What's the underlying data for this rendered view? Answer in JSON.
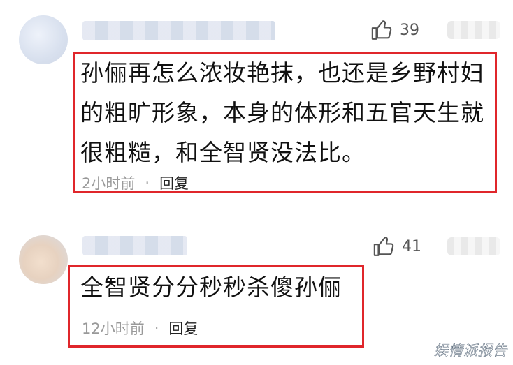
{
  "comments": [
    {
      "likes": "39",
      "text_lines": [
        "孙俪再怎么浓妆艳抹，也还是乡野村妇",
        "的粗旷形象，本身的体形和五官天生就",
        "很粗糙，和全智贤没法比。"
      ],
      "time": "2小时前",
      "dot": "·",
      "reply": "回复"
    },
    {
      "likes": "41",
      "text_lines": [
        "全智贤分分秒秒杀傻孙俪"
      ],
      "time": "12小时前",
      "dot": "·",
      "reply": "回复"
    }
  ],
  "watermark": "娱情派报告",
  "highlight_color": "#e0262b",
  "icons": [
    "thumbs-up-icon"
  ]
}
